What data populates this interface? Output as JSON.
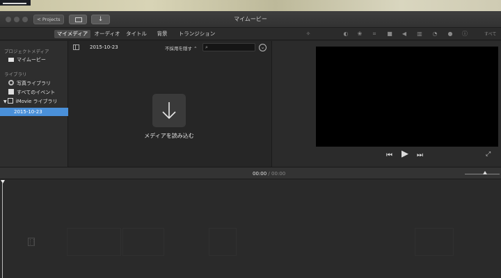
{
  "window": {
    "title": "マイムービー",
    "projects_button": "Projects"
  },
  "toolbar": {
    "tabs": [
      "マイメディア",
      "オーディオ",
      "タイトル",
      "背景",
      "トランジション"
    ],
    "active_tab": "マイメディア",
    "adjust_icons": [
      "magic-wand-icon",
      "color-balance-icon",
      "color-correction-icon",
      "crop-icon",
      "stabilization-icon",
      "volume-icon",
      "noise-reduction-icon",
      "speed-icon",
      "filter-icon",
      "info-icon"
    ],
    "tail_text": "すべて"
  },
  "sidebar": {
    "project_media_header": "プロジェクトメディア",
    "project_items": [
      "マイムービー"
    ],
    "library_header": "ライブラリ",
    "library_items": [
      "写真ライブラリ",
      "すべてのイベント",
      "iMovie ライブラリ"
    ],
    "selected_event": "2015-10-23"
  },
  "browser": {
    "date": "2015-10-23",
    "hide_rejected": "不採用を隠す ⌃",
    "search_placeholder": "",
    "import_label": "メディアを読み込む"
  },
  "timeline": {
    "current_time": "00:00",
    "separator": "/",
    "total_time": "00:00"
  },
  "colors": {
    "selection": "#4a90d9",
    "background": "#262626",
    "viewer": "#000000"
  }
}
